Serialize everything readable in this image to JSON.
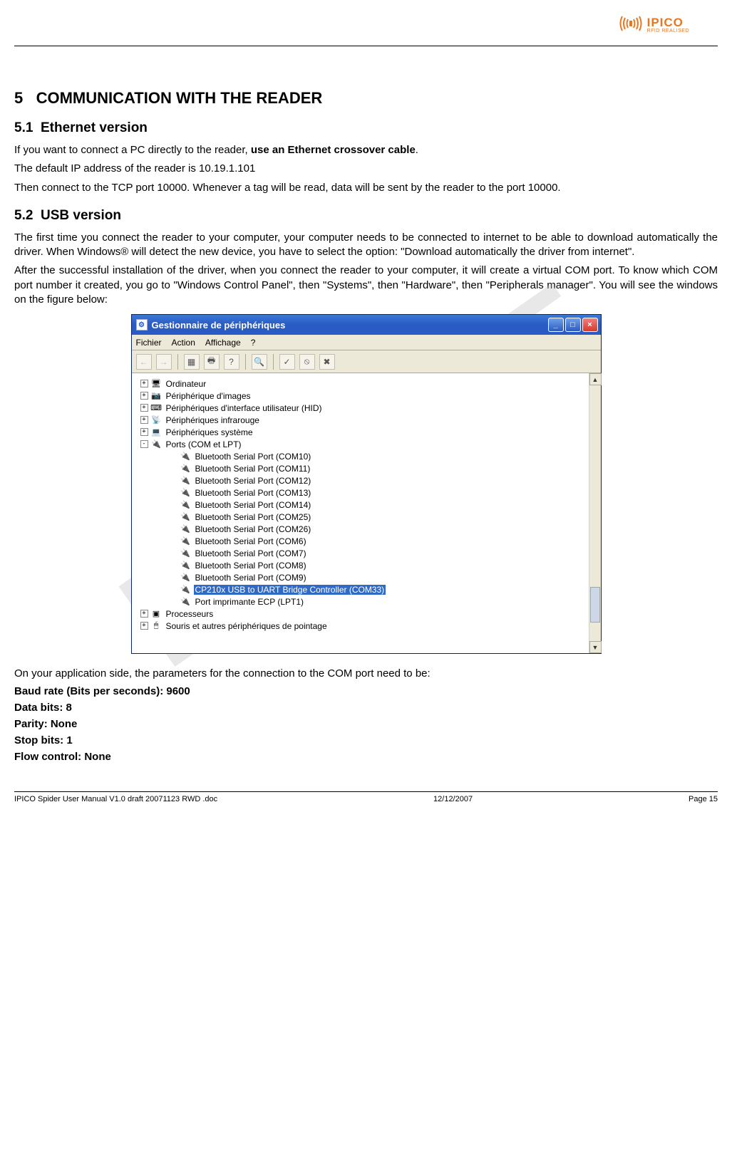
{
  "logo": {
    "name": "IPICO",
    "tagline": "RFID REALISED"
  },
  "watermark": "DRAFT",
  "h1": {
    "num": "5",
    "title": "COMMUNICATION WITH THE READER"
  },
  "s51": {
    "num": "5.1",
    "title": "Ethernet version",
    "p1a": "If you want to connect a PC directly to the reader, ",
    "p1b": "use an Ethernet crossover cable",
    "p1c": ".",
    "p2": "The default IP address of the reader is 10.19.1.101",
    "p3": "Then connect to the TCP port 10000. Whenever a tag will be read, data will be sent by the reader to the port 10000."
  },
  "s52": {
    "num": "5.2",
    "title": "USB version",
    "p1": "The first time you connect the reader to your computer, your computer needs to be connected to internet to be able to download automatically the driver. When Windows® will detect the new device, you have to select the option: \"Download automatically the driver from internet\".",
    "p2": "After the successful installation of the driver, when you connect the reader to your computer, it will create a virtual COM port. To know which COM port number it created, you go to \"Windows Control Panel\", then \"Systems\", then \"Hardware\", then \"Peripherals manager\". You will see the windows on the figure below:",
    "p3": "On your application side, the parameters for the connection to the COM port need to be:"
  },
  "params": {
    "baud": "Baud rate (Bits per seconds): 9600",
    "data": "Data bits: 8",
    "parity": "Parity: None",
    "stop": "Stop bits: 1",
    "flow": "Flow control: None"
  },
  "xp": {
    "title": "Gestionnaire de périphériques",
    "menu": {
      "m1": "Fichier",
      "m2": "Action",
      "m3": "Affichage",
      "m4": "?"
    },
    "cats": {
      "c0": "Ordinateur",
      "c1": "Périphérique d'images",
      "c2": "Périphériques d'interface utilisateur (HID)",
      "c3": "Périphériques infrarouge",
      "c4": "Périphériques système",
      "c5": "Ports (COM et LPT)",
      "c6": "Processeurs",
      "c7": "Souris et autres périphériques de pointage"
    },
    "ports": {
      "p0": "Bluetooth Serial Port (COM10)",
      "p1": "Bluetooth Serial Port (COM11)",
      "p2": "Bluetooth Serial Port (COM12)",
      "p3": "Bluetooth Serial Port (COM13)",
      "p4": "Bluetooth Serial Port (COM14)",
      "p5": "Bluetooth Serial Port (COM25)",
      "p6": "Bluetooth Serial Port (COM26)",
      "p7": "Bluetooth Serial Port (COM6)",
      "p8": "Bluetooth Serial Port (COM7)",
      "p9": "Bluetooth Serial Port (COM8)",
      "p10": "Bluetooth Serial Port (COM9)",
      "p11": "CP210x USB to UART Bridge Controller (COM33)",
      "p12": "Port imprimante ECP (LPT1)"
    }
  },
  "footer": {
    "left": "IPICO Spider User Manual V1.0 draft 20071123 RWD .doc",
    "mid": "12/12/2007",
    "right": "Page 15"
  }
}
